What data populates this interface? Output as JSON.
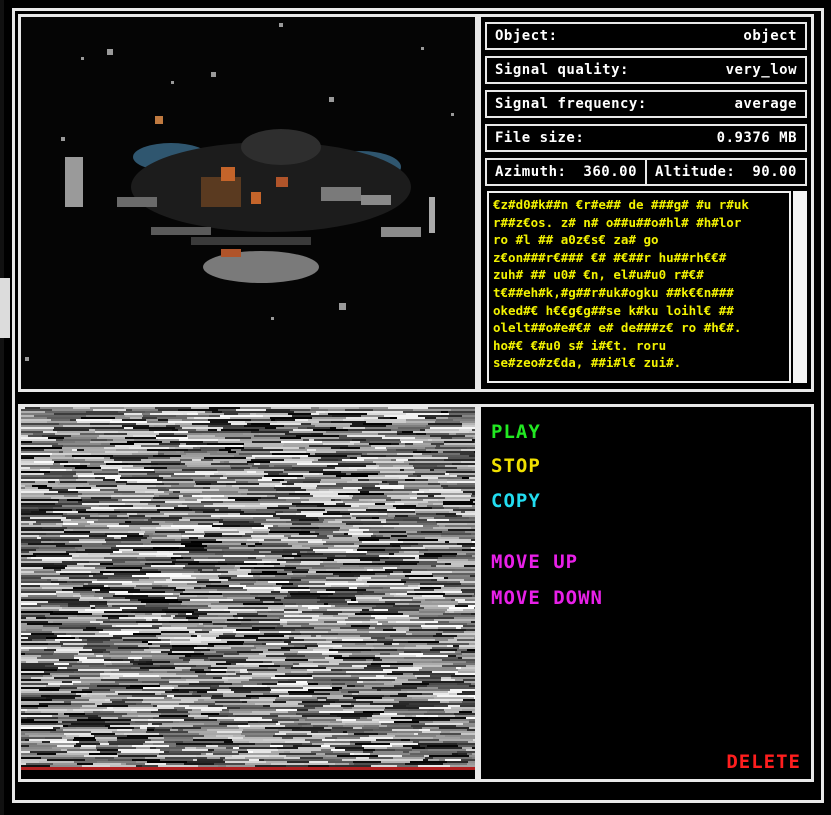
{
  "info": {
    "object_label": "Object:",
    "object_value": "object",
    "signal_quality_label": "Signal quality:",
    "signal_quality_value": "very_low",
    "signal_frequency_label": "Signal frequency:",
    "signal_frequency_value": "average",
    "file_size_label": "File size:",
    "file_size_value": "0.9376 MB",
    "azimuth_label": "Azimuth:",
    "azimuth_value": "360.00",
    "altitude_label": "Altitude:",
    "altitude_value": "90.00"
  },
  "message_lines": [
    "€z#d0#k##n €r#e## de ###g# #u r#uk",
    "r##z€os. z# n# o##u##o#hl# #h#lor",
    "ro #l ## a0z€s€ za# go",
    "z€on###r€### €# #€##r hu##rh€€#",
    "zuh# ## u0# €n, el#u#u0 r#€#",
    "t€##eh#k,#g##r#uk#ogku ##k€€n###",
    "oked#€ h€€g€g##se k#ku loihl€ ##",
    "olelt##o#e#€# e# de###z€ ro #h€#.",
    "ho#€ €#u0 s# i#€t. roru",
    "se#zeo#z€da, ##i#l€ zui#."
  ],
  "controls": {
    "play": "PLAY",
    "stop": "STOP",
    "copy": "COPY",
    "move_up": "MOVE UP",
    "move_down": "MOVE DOWN",
    "delete": "DELETE"
  },
  "colors": {
    "text_yellow": "#f2f200",
    "play": "#22e822",
    "stop": "#f0e000",
    "copy": "#22dcf0",
    "move": "#e820e8",
    "delete": "#ff1e1e"
  }
}
